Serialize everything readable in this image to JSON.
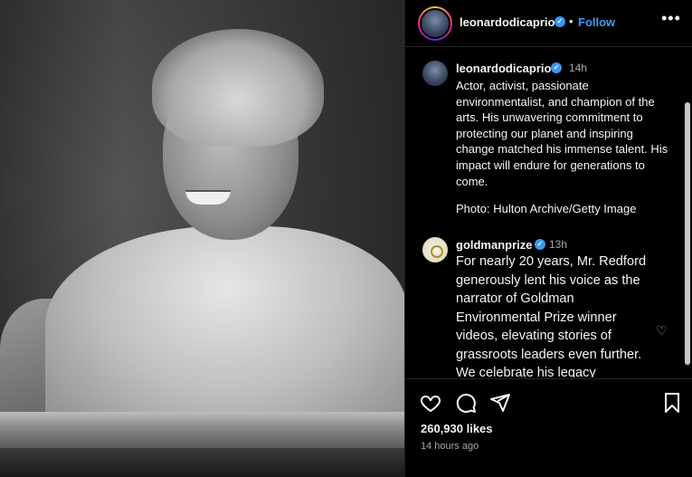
{
  "post": {
    "author": "leonardodicaprio",
    "follow_label": "Follow",
    "more_label": "•••",
    "verified_mark": "✓",
    "dot": "•"
  },
  "comments": [
    {
      "username": "leonardodicaprio",
      "time": "14h",
      "text": "Actor, activist, passionate environmentalist, and champion of the arts. His unwavering commitment to protecting our planet and inspiring change matched his immense talent. His impact will endure for generations to come.",
      "credit": "Photo: Hulton Archive/Getty Image"
    },
    {
      "username": "goldmanprize",
      "time": "13h",
      "text": "For nearly 20 years, Mr. Redford generously lent his voice as the narrator of Goldman Environmental Prize winner videos, elevating stories of grassroots leaders even further. We celebrate his legacy"
    }
  ],
  "actions": {
    "likes": "260,930 likes",
    "time_ago": "14 hours ago"
  },
  "colors": {
    "accent": "#3f9bf0",
    "verified": "#3897f0",
    "muted": "#a8a8a8"
  },
  "icons": [
    "heart-icon",
    "comment-icon",
    "share-icon",
    "bookmark-icon",
    "more-icon",
    "verified-icon"
  ]
}
